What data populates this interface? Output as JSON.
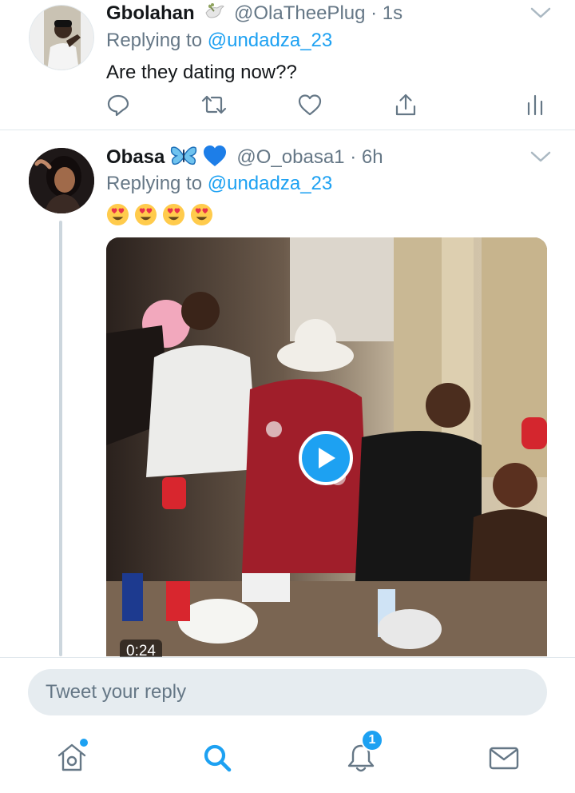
{
  "tweets": [
    {
      "name": "Gbolahan",
      "handle": "@OlaTheePlug",
      "time": "· 1s",
      "replying_prefix": "Replying to",
      "replying_to": "@undadza_23",
      "text": "Are they dating now??",
      "name_icons": [
        "dove-icon"
      ]
    },
    {
      "name": "Obasa",
      "handle": "@O_obasa1",
      "time": "· 6h",
      "replying_prefix": "Replying to",
      "replying_to": "@undadza_23",
      "emojis": [
        "heart-eyes-emoji",
        "heart-eyes-emoji",
        "heart-eyes-emoji",
        "heart-eyes-emoji"
      ],
      "name_icons": [
        "butterfly-icon",
        "blue-heart-icon"
      ],
      "media": {
        "type": "video",
        "duration": "0:24"
      }
    }
  ],
  "reply_box": {
    "placeholder": "Tweet your reply"
  },
  "nav": {
    "items": [
      "home-icon",
      "search-icon",
      "notifications-icon",
      "messages-icon"
    ],
    "notification_count": "1",
    "active": "search"
  },
  "colors": {
    "accent": "#1da1f2",
    "text_primary": "#14171a",
    "text_secondary": "#657786",
    "divider": "#e1e8ed",
    "thread_line": "#ccd6dd",
    "input_bg": "#e6ecf0"
  }
}
